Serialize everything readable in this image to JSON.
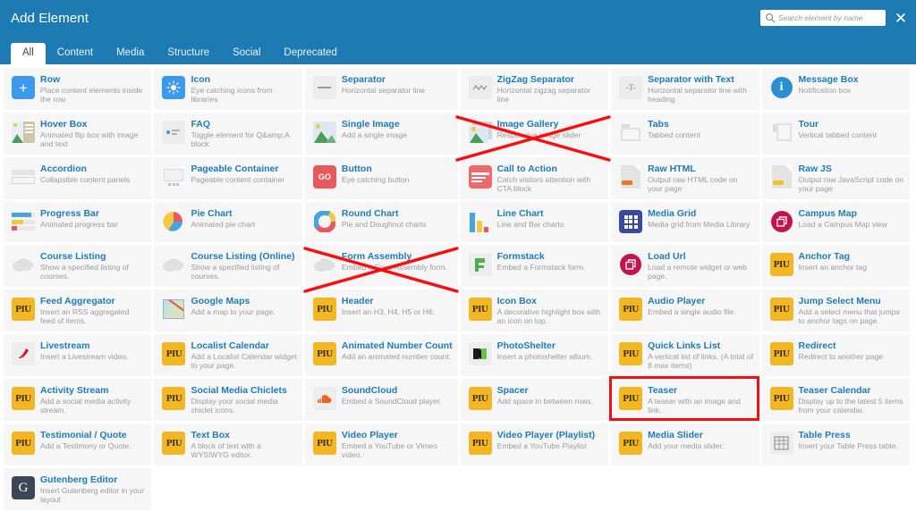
{
  "header": {
    "title": "Add Element",
    "search": {
      "placeholder": "Search element by name",
      "value": "",
      "icon": "search-icon"
    },
    "close_label": "✕",
    "bg_color": "#1d7ab3"
  },
  "tabs": [
    {
      "label": "All",
      "active": true
    },
    {
      "label": "Content",
      "active": false
    },
    {
      "label": "Media",
      "active": false
    },
    {
      "label": "Structure",
      "active": false
    },
    {
      "label": "Social",
      "active": false
    },
    {
      "label": "Deprecated",
      "active": false
    }
  ],
  "annotations": {
    "highlight_color": "#fb0d0d",
    "crossed_out": [
      "Image Gallery",
      "Form Assembly"
    ],
    "highlighted": [
      "Teaser"
    ]
  },
  "elements": [
    {
      "title": "Row",
      "desc": "Place content elements inside the row",
      "icon": "plus-square-icon",
      "icon_kind": "blue-plus"
    },
    {
      "title": "Icon",
      "desc": "Eye catching icons from libraries",
      "icon": "sun-icon",
      "icon_kind": "blue-sun"
    },
    {
      "title": "Separator",
      "desc": "Horizontal separator line",
      "icon": "horizontal-line-icon",
      "icon_kind": "gray-line"
    },
    {
      "title": "ZigZag Separator",
      "desc": "Horizontal zigzag separator line",
      "icon": "zigzag-icon",
      "icon_kind": "gray-zigzag"
    },
    {
      "title": "Separator with Text",
      "desc": "Horizontal separator line with heading",
      "icon": "separator-text-icon",
      "icon_kind": "gray-t"
    },
    {
      "title": "Message Box",
      "desc": "Notification box",
      "icon": "info-circle-icon",
      "icon_kind": "blue-info"
    },
    {
      "title": "Hover Box",
      "desc": "Animated flip box with image and text",
      "icon": "hover-box-icon",
      "icon_kind": "image-text"
    },
    {
      "title": "FAQ",
      "desc": "Toggle element for Q&amp;A block",
      "icon": "faq-icon",
      "icon_kind": "gray-faq"
    },
    {
      "title": "Single Image",
      "desc": "Add a single image",
      "icon": "image-icon",
      "icon_kind": "photo"
    },
    {
      "title": "Image Gallery",
      "desc": "Responsive image slider",
      "icon": "image-gallery-icon",
      "icon_kind": "photo-stack"
    },
    {
      "title": "Tabs",
      "desc": "Tabbed content",
      "icon": "tabs-icon",
      "icon_kind": "gray-tabs"
    },
    {
      "title": "Tour",
      "desc": "Vertical tabbed content",
      "icon": "tour-icon",
      "icon_kind": "gray-tour"
    },
    {
      "title": "Accordion",
      "desc": "Collapsible content panels",
      "icon": "accordion-icon",
      "icon_kind": "gray-accordion"
    },
    {
      "title": "Pageable Container",
      "desc": "Pageable content container",
      "icon": "pageable-icon",
      "icon_kind": "gray-pageable"
    },
    {
      "title": "Button",
      "desc": "Eye catching button",
      "icon": "go-button-icon",
      "icon_kind": "red-go"
    },
    {
      "title": "Call to Action",
      "desc": "Catch visitors attention with CTA block",
      "icon": "cta-icon",
      "icon_kind": "red-cta"
    },
    {
      "title": "Raw HTML",
      "desc": "Output raw HTML code on your page",
      "icon": "file-html-icon",
      "icon_kind": "file-orange"
    },
    {
      "title": "Raw JS",
      "desc": "Output raw JavaScript code on your page",
      "icon": "file-js-icon",
      "icon_kind": "file-yellow"
    },
    {
      "title": "Progress Bar",
      "desc": "Animated progress bar",
      "icon": "progress-bar-icon",
      "icon_kind": "bars"
    },
    {
      "title": "Pie Chart",
      "desc": "Animated pie chart",
      "icon": "pie-chart-icon",
      "icon_kind": "pie"
    },
    {
      "title": "Round Chart",
      "desc": "Pie and Doughnut charts",
      "icon": "doughnut-chart-icon",
      "icon_kind": "doughnut"
    },
    {
      "title": "Line Chart",
      "desc": "Line and Bar charts",
      "icon": "line-chart-icon",
      "icon_kind": "barchart"
    },
    {
      "title": "Media Grid",
      "desc": "Media grid from Media Library",
      "icon": "media-grid-icon",
      "icon_kind": "grid-navy"
    },
    {
      "title": "Campus Map",
      "desc": "Load a Campus Map view",
      "icon": "campus-map-icon",
      "icon_kind": "crimson-circle"
    },
    {
      "title": "Course Listing",
      "desc": "Show a specified listing of courses.",
      "icon": "cloud-icon",
      "icon_kind": "gray-cloud"
    },
    {
      "title": "Course Listing (Online)",
      "desc": "Show a specified listing of courses.",
      "icon": "cloud-icon",
      "icon_kind": "gray-cloud"
    },
    {
      "title": "Form Assembly",
      "desc": "Embed a Form Assembly form.",
      "icon": "cloud-icon",
      "icon_kind": "gray-cloud"
    },
    {
      "title": "Formstack",
      "desc": "Embed a Formstack form.",
      "icon": "formstack-icon",
      "icon_kind": "green-form"
    },
    {
      "title": "Load Url",
      "desc": "Load a remote widget or web page.",
      "icon": "load-url-icon",
      "icon_kind": "crimson-circle"
    },
    {
      "title": "Anchor Tag",
      "desc": "Insert an anchor tag",
      "icon": "plu-icon",
      "icon_kind": "plu"
    },
    {
      "title": "Feed Aggregator",
      "desc": "Insert an RSS aggregated feed of items.",
      "icon": "plu-icon",
      "icon_kind": "plu"
    },
    {
      "title": "Google Maps",
      "desc": "Add a map to your page.",
      "icon": "google-maps-icon",
      "icon_kind": "map"
    },
    {
      "title": "Header",
      "desc": "Insert an H3, H4, H5 or H6.",
      "icon": "plu-icon",
      "icon_kind": "plu"
    },
    {
      "title": "Icon Box",
      "desc": "A decorative highlight box with an icon on top.",
      "icon": "plu-icon",
      "icon_kind": "plu"
    },
    {
      "title": "Audio Player",
      "desc": "Embed a single audio file.",
      "icon": "plu-icon",
      "icon_kind": "plu"
    },
    {
      "title": "Jump Select Menu",
      "desc": "Add a select menu that jumps to anchor tags on page.",
      "icon": "plu-icon",
      "icon_kind": "plu"
    },
    {
      "title": "Livestream",
      "desc": "Insert a Livestream video.",
      "icon": "livestream-icon",
      "icon_kind": "livestream"
    },
    {
      "title": "Localist Calendar",
      "desc": "Add a Localist Calendar widget to your page.",
      "icon": "plu-icon",
      "icon_kind": "plu"
    },
    {
      "title": "Animated Number Count",
      "desc": "Add an animated number count.",
      "icon": "plu-icon",
      "icon_kind": "plu"
    },
    {
      "title": "PhotoShelter",
      "desc": "Insert a photoshelter album.",
      "icon": "photoshelter-icon",
      "icon_kind": "photoshelter"
    },
    {
      "title": "Quick Links List",
      "desc": "A vertical list of links. (A total of 8 max items)",
      "icon": "plu-icon",
      "icon_kind": "plu"
    },
    {
      "title": "Redirect",
      "desc": "Redirect to another page",
      "icon": "plu-icon",
      "icon_kind": "plu"
    },
    {
      "title": "Activity Stream",
      "desc": "Add a social media activity stream.",
      "icon": "plu-icon",
      "icon_kind": "plu"
    },
    {
      "title": "Social Media Chiclets",
      "desc": "Display your social media chiclet icons.",
      "icon": "plu-icon",
      "icon_kind": "plu"
    },
    {
      "title": "SoundCloud",
      "desc": "Embed a SoundCloud player.",
      "icon": "soundcloud-icon",
      "icon_kind": "soundcloud"
    },
    {
      "title": "Spacer",
      "desc": "Add space in between rows.",
      "icon": "plu-icon",
      "icon_kind": "plu"
    },
    {
      "title": "Teaser",
      "desc": "A teaser with an image and link.",
      "icon": "plu-icon",
      "icon_kind": "plu"
    },
    {
      "title": "Teaser Calendar",
      "desc": "Display up to the latest 5 items from your calendar.",
      "icon": "plu-icon",
      "icon_kind": "plu"
    },
    {
      "title": "Testimonial / Quote",
      "desc": "Add a Testimony or Quote.",
      "icon": "plu-icon",
      "icon_kind": "plu"
    },
    {
      "title": "Text Box",
      "desc": "A block of text with a WYSIWYG editor.",
      "icon": "plu-icon",
      "icon_kind": "plu"
    },
    {
      "title": "Video Player",
      "desc": "Embed a YouTube or Vimeo video.",
      "icon": "plu-icon",
      "icon_kind": "plu"
    },
    {
      "title": "Video Player (Playlist)",
      "desc": "Embed a YouTube Playlist",
      "icon": "plu-icon",
      "icon_kind": "plu"
    },
    {
      "title": "Media Slider",
      "desc": "Add your media slider.",
      "icon": "plu-icon",
      "icon_kind": "plu"
    },
    {
      "title": "Table Press",
      "desc": "Insert your Table Press table.",
      "icon": "table-press-icon",
      "icon_kind": "table"
    },
    {
      "title": "Gutenberg Editor",
      "desc": "Insert Gutenberg editor in your layout",
      "icon": "gutenberg-icon",
      "icon_kind": "gutenberg"
    }
  ]
}
